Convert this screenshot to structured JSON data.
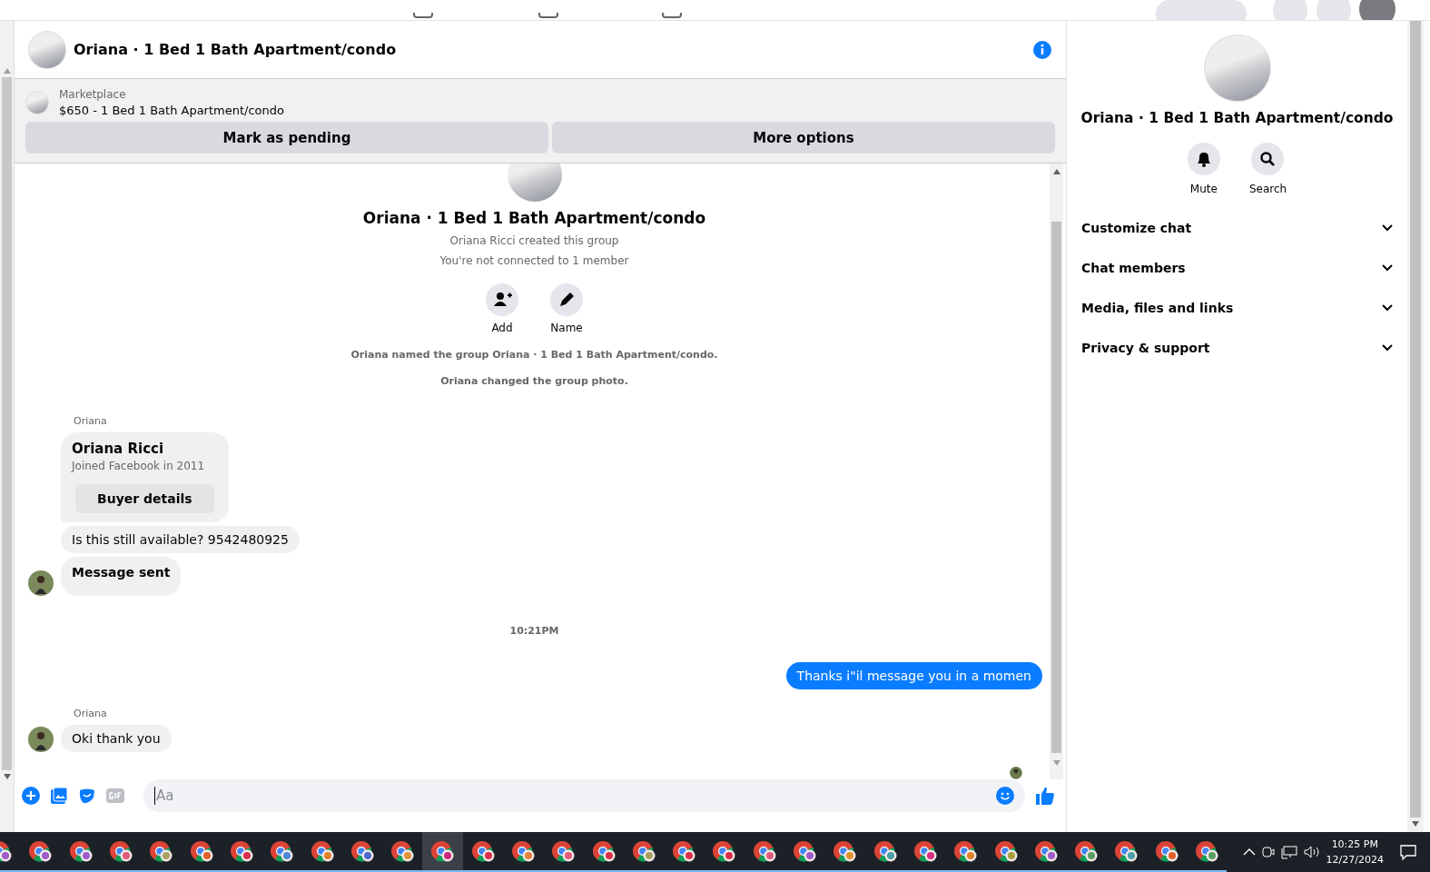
{
  "conversation": {
    "title": "Oriana · 1 Bed 1 Bath Apartment/condo"
  },
  "listing": {
    "source": "Marketplace",
    "text": "$650 - 1 Bed 1 Bath Apartment/condo",
    "buttons": [
      "Mark as pending",
      "More options"
    ]
  },
  "group_intro": {
    "title": "Oriana · 1 Bed 1 Bath Apartment/condo",
    "lines": [
      "Oriana Ricci created this group",
      "You're not connected to 1 member"
    ],
    "actions": [
      {
        "kind": "add",
        "label": "Add"
      },
      {
        "kind": "name",
        "label": "Name"
      }
    ]
  },
  "events": [
    "Oriana named the group Oriana · 1 Bed 1 Bath Apartment/condo.",
    "Oriana changed the group photo."
  ],
  "messages": [
    {
      "kind": "profile",
      "sender": "Oriana",
      "name": "Oriana Ricci",
      "detail": "Joined Facebook in 2011",
      "button": "Buyer details",
      "avatar": false
    },
    {
      "kind": "text",
      "text": "Is this still available? 9542480925",
      "avatar": false
    },
    {
      "kind": "bold",
      "text": "Message sent",
      "avatar": true
    },
    {
      "kind": "time",
      "text": "10:21PM"
    },
    {
      "kind": "outgoing",
      "text": "Thanks i\"il message you in a momen"
    },
    {
      "kind": "text",
      "sender": "Oriana",
      "text": "Oki thank you",
      "avatar": true
    }
  ],
  "composer": {
    "placeholder": "Aa"
  },
  "details": {
    "title": "Oriana · 1 Bed 1 Bath Apartment/condo",
    "actions": [
      {
        "kind": "mute",
        "label": "Mute"
      },
      {
        "kind": "search",
        "label": "Search"
      }
    ],
    "sections": [
      {
        "label": "Customize chat",
        "expanded": false
      },
      {
        "label": "Chat members",
        "expanded": false
      },
      {
        "label": "Media, files and links",
        "expanded": false
      },
      {
        "label": "Privacy & support",
        "expanded": false
      }
    ]
  },
  "taskbar": {
    "apps": [
      {
        "color": "#9c5cc9",
        "selected": false
      },
      {
        "color": "#9c5cc9",
        "selected": false
      },
      {
        "color": "#9c5cc9",
        "selected": false
      },
      {
        "color": "#e05a7a",
        "selected": false
      },
      {
        "color": "#a8a060",
        "selected": false
      },
      {
        "color": "#e0602a",
        "selected": false
      },
      {
        "color": "#d8304a",
        "selected": false
      },
      {
        "color": "#4a88d8",
        "selected": false
      },
      {
        "color": "#e0802a",
        "selected": false
      },
      {
        "color": "#4a68c8",
        "selected": false
      },
      {
        "color": "#e0903a",
        "selected": false
      },
      {
        "color": "#c82880",
        "selected": true
      },
      {
        "color": "#d8304a",
        "selected": false
      },
      {
        "color": "#e0803a",
        "selected": false
      },
      {
        "color": "#e05a7a",
        "selected": false
      },
      {
        "color": "#d8304a",
        "selected": false
      },
      {
        "color": "#a8a060",
        "selected": false
      },
      {
        "color": "#d8304a",
        "selected": false
      },
      {
        "color": "#d8304a",
        "selected": false
      },
      {
        "color": "#e05a7a",
        "selected": false
      },
      {
        "color": "#9c5cc9",
        "selected": false
      },
      {
        "color": "#e0902a",
        "selected": false
      },
      {
        "color": "#48a0a8",
        "selected": false
      },
      {
        "color": "#d83080",
        "selected": false
      },
      {
        "color": "#e0802a",
        "selected": false
      },
      {
        "color": "#a8a040",
        "selected": false
      },
      {
        "color": "#9c5cc9",
        "selected": false
      },
      {
        "color": "#58a060",
        "selected": false
      },
      {
        "color": "#48a0a8",
        "selected": false
      },
      {
        "color": "#e0602a",
        "selected": false
      },
      {
        "color": "#58a060",
        "selected": false
      }
    ],
    "time": "10:25 PM",
    "date": "12/27/2024"
  }
}
